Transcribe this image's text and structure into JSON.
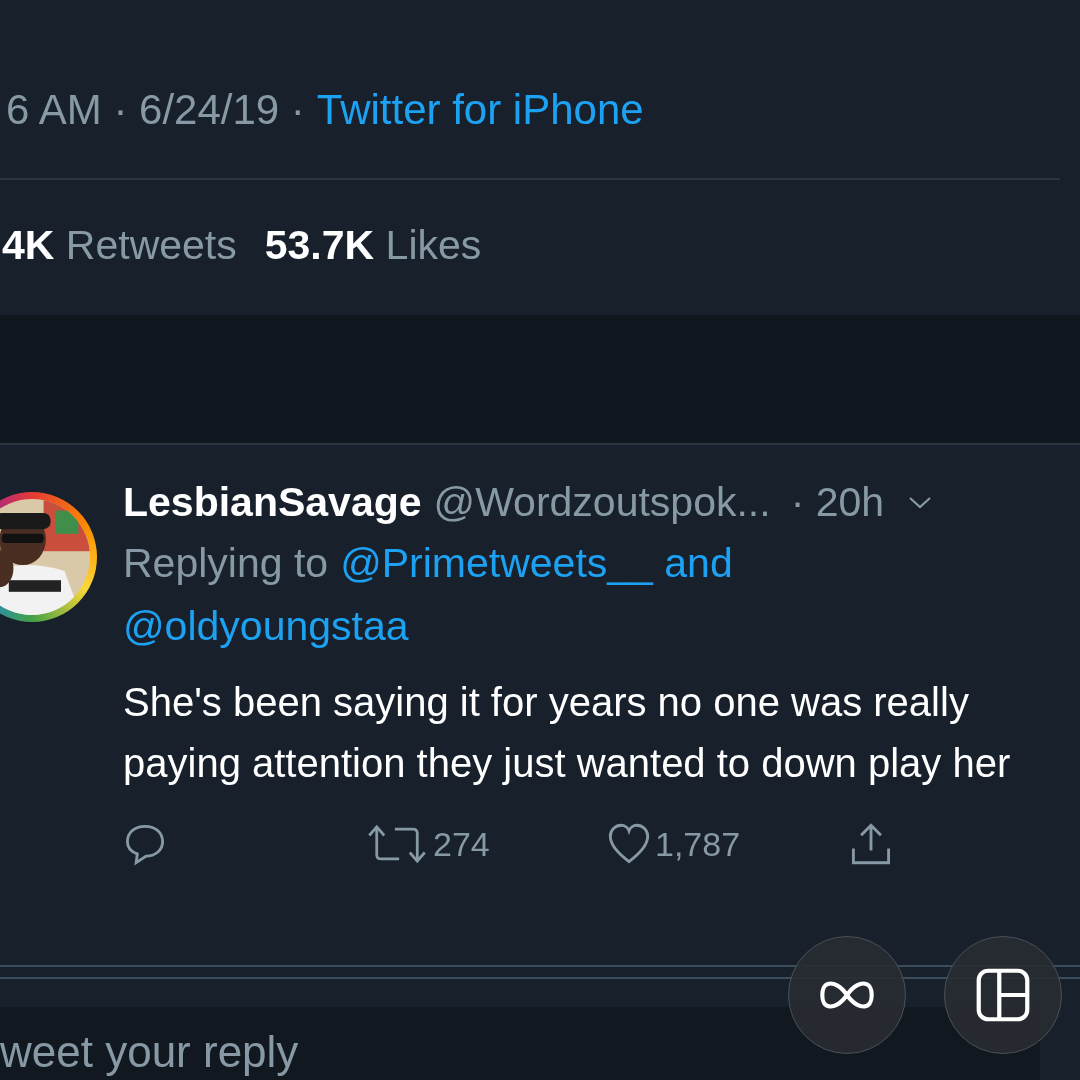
{
  "tweet_meta": {
    "time": "6 AM · 6/24/19 ·",
    "source": "Twitter for iPhone"
  },
  "stats": [
    {
      "count": "4K",
      "label": "Retweets"
    },
    {
      "count": "53.7K",
      "label": "Likes"
    }
  ],
  "reply": {
    "name": "LesbianSavage",
    "handle": "@Wordzoutspok...",
    "age": "· 20h",
    "replying_to": "Replying to",
    "mentions": [
      "@Primetweets__ and",
      "@oldyoungstaa"
    ],
    "text": "She's been saying it for years no one was really paying attention they just wanted to down play her",
    "actions": [
      {
        "kind": "comment"
      },
      {
        "kind": "retweet",
        "count": "274"
      },
      {
        "kind": "like",
        "count": "1,787"
      },
      {
        "kind": "share"
      }
    ]
  },
  "composer": {
    "placeholder": "weet your reply"
  },
  "overlay_buttons": [
    {
      "kind": "infinity"
    },
    {
      "kind": "layout"
    }
  ]
}
